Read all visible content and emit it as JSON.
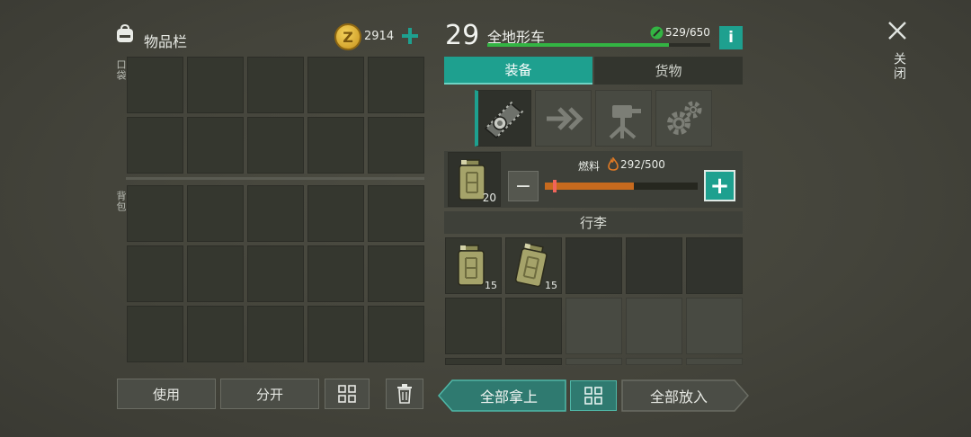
{
  "inventory": {
    "title": "物品栏",
    "coins": "2914",
    "coin_symbol": "Z",
    "pocket_label": "口袋",
    "backpack_label": "背包",
    "pocket_rows": 2,
    "backpack_rows": 3,
    "cols": 5
  },
  "vehicle": {
    "level": "29",
    "name": "全地形车",
    "durability": "529/650",
    "durability_fraction": 0.814,
    "info_label": "i"
  },
  "tabs": [
    {
      "label": "装备",
      "active": true
    },
    {
      "label": "货物",
      "active": false
    }
  ],
  "equipment_slots": [
    {
      "icon": "tracks-icon",
      "active": true
    },
    {
      "icon": "arrow-icon",
      "active": false
    },
    {
      "icon": "turret-icon",
      "active": false
    },
    {
      "icon": "gears-icon",
      "active": false
    }
  ],
  "fuel": {
    "label": "燃料",
    "value": "292/500",
    "fraction": 0.584,
    "canister_count": "20",
    "minus_label": "−",
    "plus_label": "+"
  },
  "trunk": {
    "title": "行李",
    "items": [
      {
        "icon": "jerry-can-icon",
        "count": "15"
      },
      {
        "icon": "jerry-can-icon",
        "count": "15"
      }
    ]
  },
  "buttons": {
    "use": "使用",
    "split": "分开",
    "take_all": "全部拿上",
    "put_all": "全部放入",
    "sort_icon": "sort-grid-icon",
    "trash_icon": "trash-icon"
  },
  "close": {
    "label": "关闭",
    "icon": "close-icon"
  },
  "colors": {
    "accent": "#1ea08f",
    "green": "#33b443",
    "fuel": "#c76a1e",
    "background": "#44443b"
  }
}
